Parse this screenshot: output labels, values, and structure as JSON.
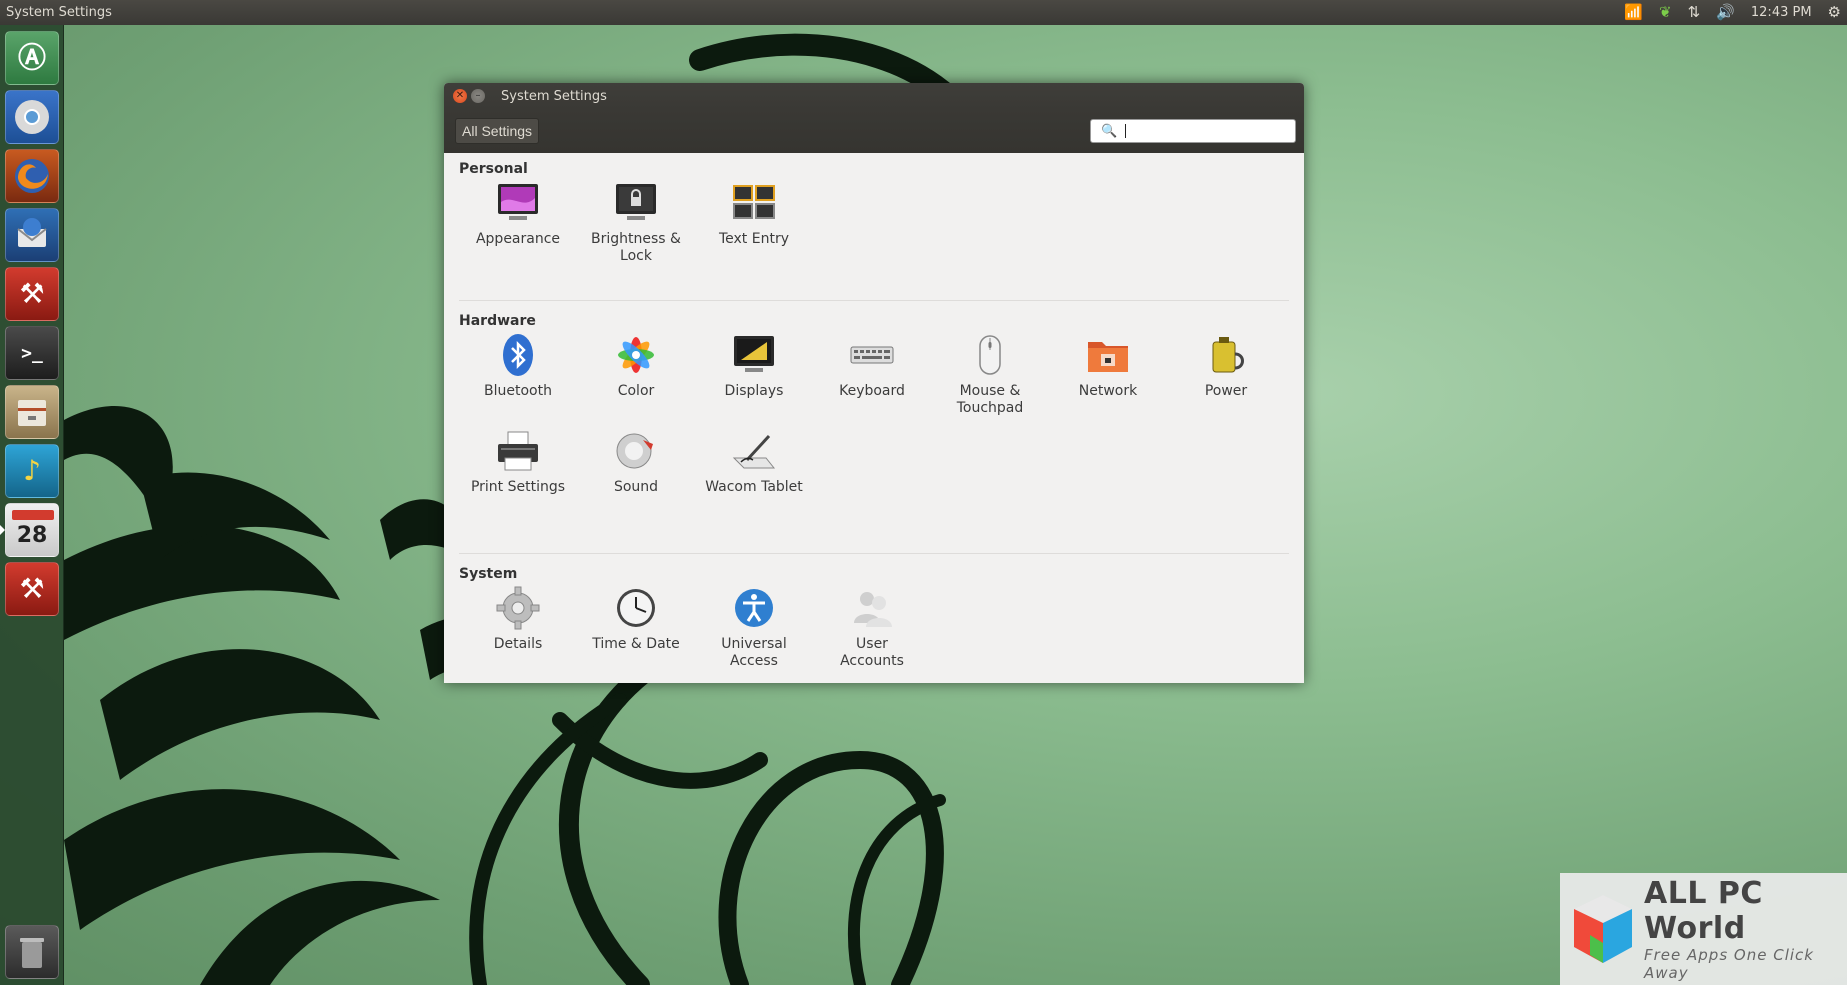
{
  "top_panel": {
    "title": "System Settings",
    "clock": "12:43 PM",
    "indicators": [
      "network-wifi-icon",
      "tomboy-icon",
      "transfer-icon",
      "volume-icon",
      "session-gear-icon"
    ]
  },
  "launcher": {
    "items": [
      {
        "name": "ubuntu-software-center",
        "icon": "launcher-a-icon"
      },
      {
        "name": "chromium",
        "icon": "chromium-icon"
      },
      {
        "name": "firefox",
        "icon": "firefox-icon"
      },
      {
        "name": "thunderbird",
        "icon": "thunderbird-icon"
      },
      {
        "name": "system-tools",
        "icon": "tools-icon"
      },
      {
        "name": "terminal",
        "icon": "terminal-icon",
        "glyph": ">_"
      },
      {
        "name": "files",
        "icon": "files-icon"
      },
      {
        "name": "music",
        "icon": "music-player-icon"
      },
      {
        "name": "calendar",
        "icon": "calendar-icon",
        "glyph": "28"
      },
      {
        "name": "system-settings",
        "icon": "settings-icon",
        "active": true
      },
      {
        "name": "trash",
        "icon": "trash-icon"
      }
    ]
  },
  "window": {
    "title": "System Settings",
    "all_settings_label": "All Settings",
    "search": {
      "value": "",
      "placeholder": ""
    },
    "sections": [
      {
        "title": "Personal",
        "items": [
          {
            "label": "Appearance",
            "icon": "appearance-icon"
          },
          {
            "label": "Brightness &\nLock",
            "icon": "brightness-lock-icon"
          },
          {
            "label": "Text Entry",
            "icon": "text-entry-icon"
          }
        ]
      },
      {
        "title": "Hardware",
        "items": [
          {
            "label": "Bluetooth",
            "icon": "bluetooth-icon"
          },
          {
            "label": "Color",
            "icon": "color-icon"
          },
          {
            "label": "Displays",
            "icon": "displays-icon"
          },
          {
            "label": "Keyboard",
            "icon": "keyboard-icon"
          },
          {
            "label": "Mouse &\nTouchpad",
            "icon": "mouse-icon"
          },
          {
            "label": "Network",
            "icon": "network-icon"
          },
          {
            "label": "Power",
            "icon": "power-icon"
          },
          {
            "label": "Print Settings",
            "icon": "printer-icon"
          },
          {
            "label": "Sound",
            "icon": "sound-icon"
          },
          {
            "label": "Wacom Tablet",
            "icon": "wacom-tablet-icon"
          }
        ]
      },
      {
        "title": "System",
        "items": [
          {
            "label": "Details",
            "icon": "details-gear-icon"
          },
          {
            "label": "Time & Date",
            "icon": "clock-icon"
          },
          {
            "label": "Universal\nAccess",
            "icon": "universal-access-icon"
          },
          {
            "label": "User\nAccounts",
            "icon": "user-accounts-icon"
          }
        ]
      }
    ]
  },
  "watermark": {
    "title": "ALL PC World",
    "tagline": "Free Apps One Click Away"
  },
  "colors": {
    "panel": "#3a3935",
    "window_bg": "#f2f1f0",
    "close_button": "#df4b1f",
    "wallpaper_green": "#8cbd90"
  }
}
